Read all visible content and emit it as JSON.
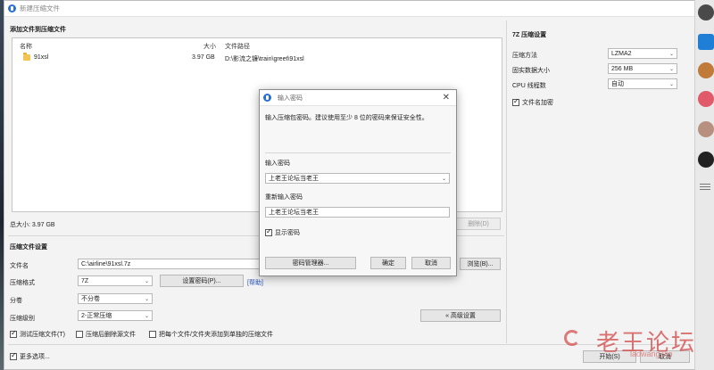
{
  "window": {
    "title": "新建压缩文件"
  },
  "files_section": {
    "heading": "添加文件到压缩文件",
    "columns": [
      "名称",
      "大小",
      "文件路径"
    ],
    "rows": [
      {
        "name": "91xsl",
        "size": "3.97 GB",
        "path": "D:\\影流之镰\\train\\greet\\91xsl"
      }
    ],
    "total": "总大小: 3.97 GB",
    "delete_button": "删除(D)"
  },
  "settings": {
    "heading": "压缩文件设置",
    "filename_label": "文件名",
    "filename_value": "C:\\airline\\91xsl.7z",
    "browse_button": "浏览(B)...",
    "format_label": "压缩格式",
    "format_value": "7Z",
    "set_password_button": "设置密码(P)...",
    "help_link": "[帮助]",
    "split_label": "分卷",
    "split_value": "不分卷",
    "level_label": "压缩级别",
    "level_value": "2-正常压缩",
    "advanced_button": "« 高级设置",
    "test_checkbox": "测试压缩文件(T)",
    "delete_after_checkbox": "压缩后删除源文件",
    "each_separate_checkbox": "把每个文件/文件夹添加到单独的压缩文件",
    "more_options_checkbox": "更多选项...",
    "start_button": "开始(S)",
    "cancel_button": "取消"
  },
  "sevenzip": {
    "heading": "7Z 压缩设置",
    "method_label": "压缩方法",
    "method_value": "LZMA2",
    "dict_label": "固实数据大小",
    "dict_value": "256 MB",
    "threads_label": "CPU 线程数",
    "threads_value": "自动",
    "encrypt_names_checkbox": "文件名加密"
  },
  "password_dialog": {
    "title": "输入密码",
    "hint": "输入压缩包密码。建议使用至少 8 位的密码来保证安全性。",
    "password_label": "输入密码",
    "password_value": "上老王论坛当老王",
    "confirm_label": "重新输入密码",
    "confirm_value": "上老王论坛当老王",
    "show_password_checkbox": "显示密码",
    "manager_button": "密码管理器...",
    "ok_button": "确定",
    "cancel_button": "取消"
  },
  "watermark": {
    "text": "老王论坛",
    "subtext": "laowang.vip"
  }
}
